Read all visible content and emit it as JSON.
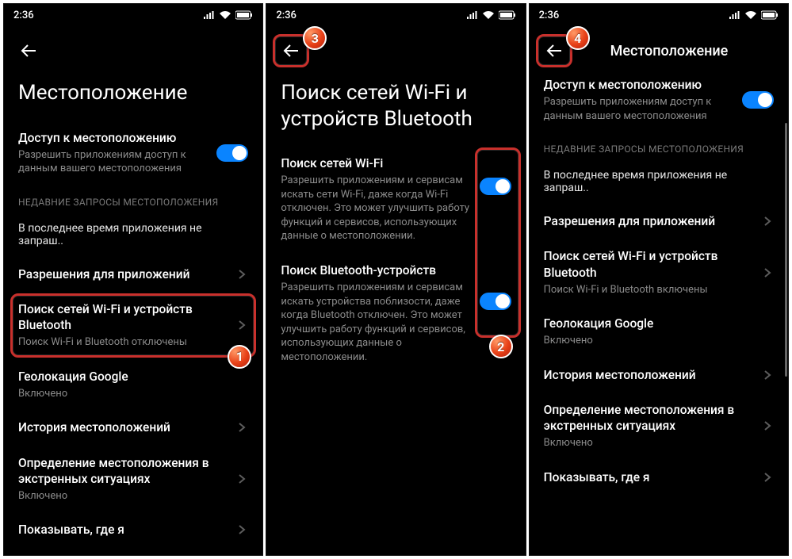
{
  "status": {
    "time": "2:36"
  },
  "screen1": {
    "title": "Местоположение",
    "access": {
      "title": "Доступ к местоположению",
      "sub": "Разрешить приложениям доступ к данным вашего местоположения"
    },
    "section": "НЕДАВНИЕ ЗАПРОСЫ МЕСТОПОЛОЖЕНИЯ",
    "recent": "В последнее время приложения не запраш..",
    "perm": "Разрешения для приложений",
    "scan": {
      "title": "Поиск сетей Wi-Fi и устройств Bluetooth",
      "sub": "Поиск Wi-Fi и Bluetooth отключены"
    },
    "google": {
      "title": "Геолокация Google",
      "sub": "Включено"
    },
    "history": "История местоположений",
    "emergency": {
      "title": "Определение местоположения в экстренных ситуациях",
      "sub": "Включено"
    },
    "share": "Показывать, где я"
  },
  "screen2": {
    "title": "Поиск сетей Wi-Fi и устройств Bluetooth",
    "wifi": {
      "title": "Поиск сетей Wi-Fi",
      "sub": "Разрешить приложениям и сервисам искать сети Wi-Fi, даже когда Wi-Fi отключен. Это может улучшить работу функций и сервисов, использующих данные о местоположении."
    },
    "bt": {
      "title": "Поиск Bluetooth-устройств",
      "sub": "Разрешить приложениям и сервисам искать устройства поблизости, даже когда Bluetooth отключен. Это может улучшить работу функций и сервисов, использующих данные о местоположении."
    }
  },
  "screen3": {
    "title": "Местоположение",
    "access": {
      "title": "Доступ к местоположению",
      "sub": "Разрешить приложениям доступ к данным вашего местоположения"
    },
    "section": "НЕДАВНИЕ ЗАПРОСЫ МЕСТОПОЛОЖЕНИЯ",
    "recent": "В последнее время приложения не запраш..",
    "perm": "Разрешения для приложений",
    "scan": {
      "title": "Поиск сетей Wi-Fi и устройств Bluetooth",
      "sub": "Поиск Wi-Fi и Bluetooth включены"
    },
    "google": {
      "title": "Геолокация Google",
      "sub": "Включено"
    },
    "history": "История местоположений",
    "emergency": {
      "title": "Определение местоположения в экстренных ситуациях",
      "sub": "Включено"
    },
    "share": "Показывать, где я"
  },
  "markers": {
    "m1": "1",
    "m2": "2",
    "m3": "3",
    "m4": "4"
  }
}
